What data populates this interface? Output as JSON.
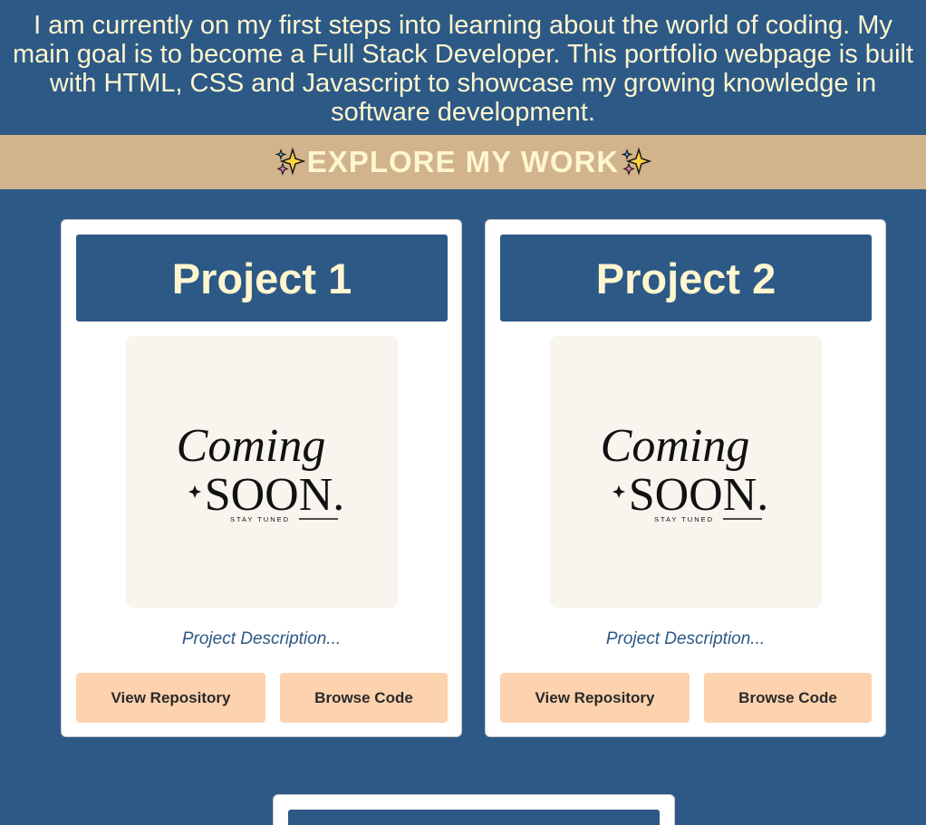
{
  "intro": {
    "text": "I am currently on my first steps into learning about the world of coding. My main goal is to become a Full Stack Developer. This portfolio webpage is built with HTML, CSS and Javascript to showcase my growing knowledge in software development."
  },
  "explore": {
    "title": "EXPLORE MY WORK",
    "icon": "sparkles-emoji"
  },
  "projects": [
    {
      "title": "Project 1",
      "image": {
        "line1": "Coming",
        "line2": "SOON.",
        "tagline": "STAY TUNED"
      },
      "description": "Project Description...",
      "repo_label": "View Repository",
      "code_label": "Browse Code"
    },
    {
      "title": "Project 2",
      "image": {
        "line1": "Coming",
        "line2": "SOON.",
        "tagline": "STAY TUNED"
      },
      "description": "Project Description...",
      "repo_label": "View Repository",
      "code_label": "Browse Code"
    }
  ],
  "colors": {
    "background": "#2d5986",
    "accent_bar": "#d1b38c",
    "title_text": "#fff6cf",
    "button": "#fdd2ae"
  }
}
